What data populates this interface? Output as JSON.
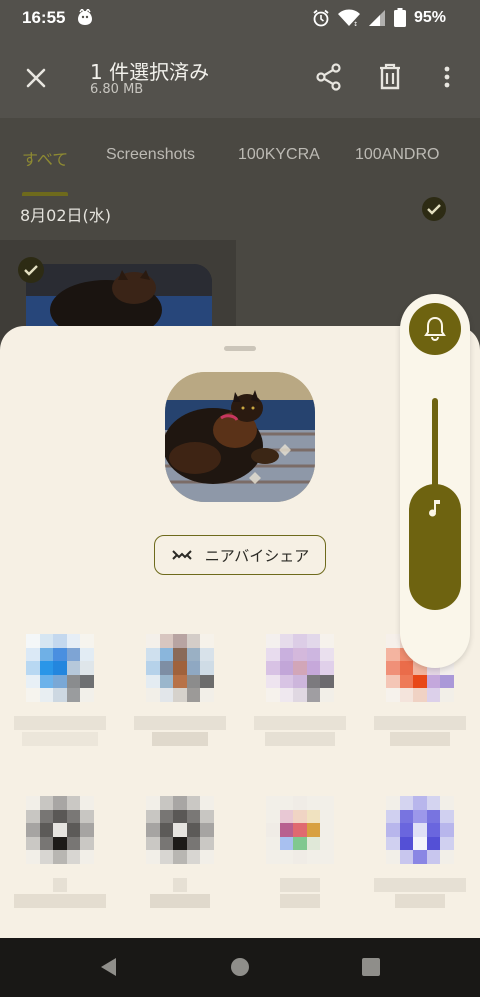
{
  "status_bar": {
    "time": "16:55",
    "battery_percent": "95%"
  },
  "app_bar": {
    "title": "1 件選択済み",
    "subtitle": "6.80 MB"
  },
  "tabs": [
    {
      "label": "すべて",
      "active": true
    },
    {
      "label": "Screenshots",
      "active": false
    },
    {
      "label": "100KYCRA",
      "active": false
    },
    {
      "label": "100ANDRO",
      "active": false
    }
  ],
  "gallery": {
    "date_header": "8月02日(水)"
  },
  "share_sheet": {
    "nearby_share_label": "ニアバイシェア"
  },
  "icons": {
    "close": "close-icon",
    "share": "share-icon",
    "delete": "delete-icon",
    "more": "more-vert-icon",
    "nearby": "nearby-share-icon",
    "ringer": "bell-icon",
    "media": "music-note-icon"
  },
  "colors": {
    "accent": "#6e6310",
    "sheet_background": "#f6f0e4",
    "scrim": "#4a4842"
  }
}
